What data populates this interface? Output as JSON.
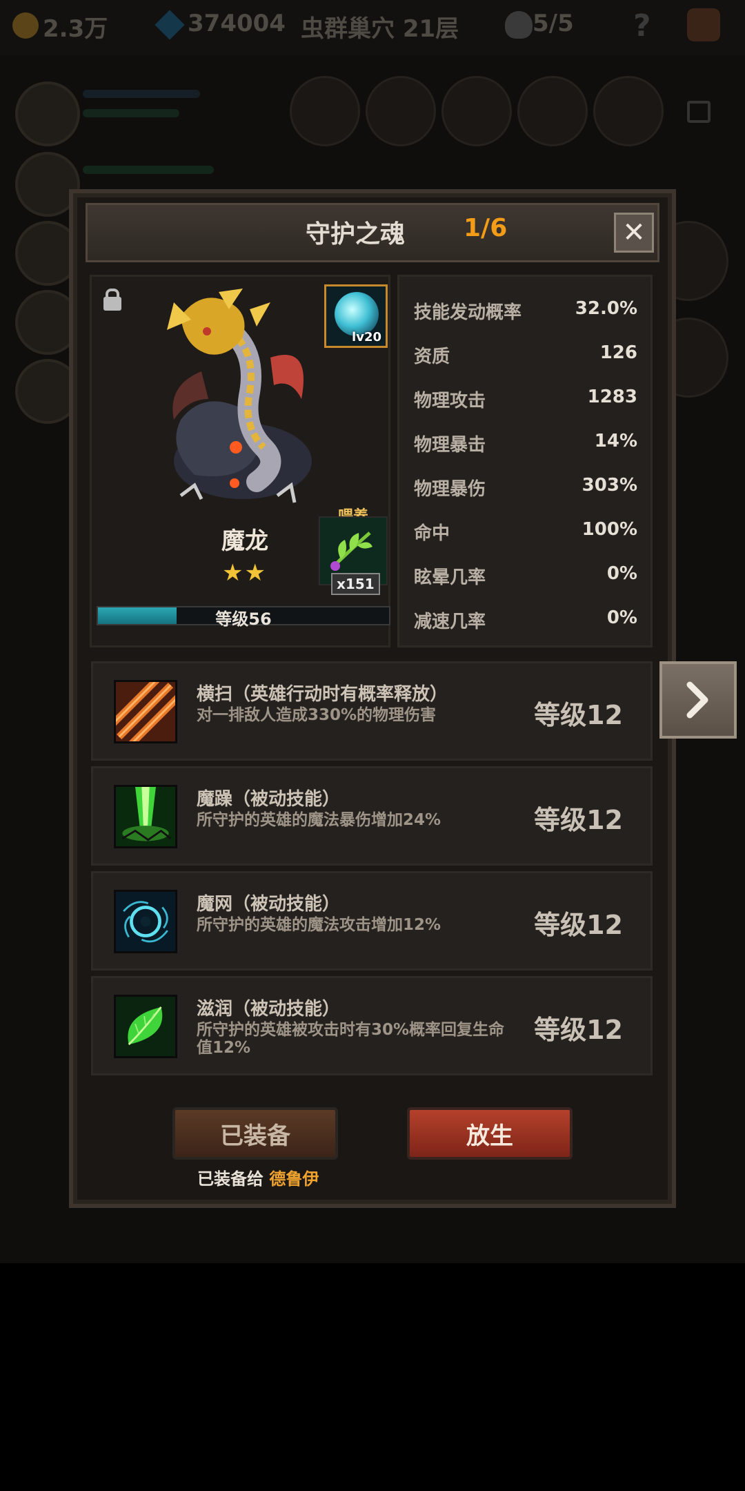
{
  "topbar": {
    "gold": "2.3万",
    "gems": "374004",
    "stage": "虫群巢穴 21层",
    "skulls": "5/5",
    "help": "?"
  },
  "dialog": {
    "title": "守护之魂",
    "page": "1/6",
    "close": "✕"
  },
  "hero": {
    "name": "魔龙",
    "stars": "★★",
    "skill_gem_level": "lv20",
    "feed_label": "喂养",
    "feed_count": "x151",
    "level_text": "等级56",
    "level_progress": 0.27
  },
  "stats": [
    {
      "label": "技能发动概率",
      "value": "32.0%"
    },
    {
      "label": "资质",
      "value": "126"
    },
    {
      "label": "物理攻击",
      "value": "1283"
    },
    {
      "label": "物理暴击",
      "value": "14%"
    },
    {
      "label": "物理暴伤",
      "value": "303%"
    },
    {
      "label": "命中",
      "value": "100%"
    },
    {
      "label": "眩晕几率",
      "value": "0%"
    },
    {
      "label": "减速几率",
      "value": "0%"
    }
  ],
  "skills": [
    {
      "name": "横扫（英雄行动时有概率释放）",
      "desc": "对一排敌人造成330%的物理伤害",
      "level": "等级12",
      "icon": "slash-icon"
    },
    {
      "name": "魔躁（被动技能）",
      "desc": "所守护的英雄的魔法暴伤增加24%",
      "level": "等级12",
      "icon": "green-beam-icon"
    },
    {
      "name": "魔网（被动技能）",
      "desc": "所守护的英雄的魔法攻击增加12%",
      "level": "等级12",
      "icon": "vortex-icon"
    },
    {
      "name": "滋润（被动技能）",
      "desc": "所守护的英雄被攻击时有30%概率回复生命值12%",
      "level": "等级12",
      "icon": "leaf-icon"
    }
  ],
  "buttons": {
    "equipped": "已装备",
    "release": "放生",
    "equipped_to_prefix": "已装备给",
    "equipped_to_hero": "德鲁伊"
  },
  "colors": {
    "accent_orange": "#f39c18",
    "level_bar": "#2aa7b3",
    "release_button": "#b4412b"
  }
}
